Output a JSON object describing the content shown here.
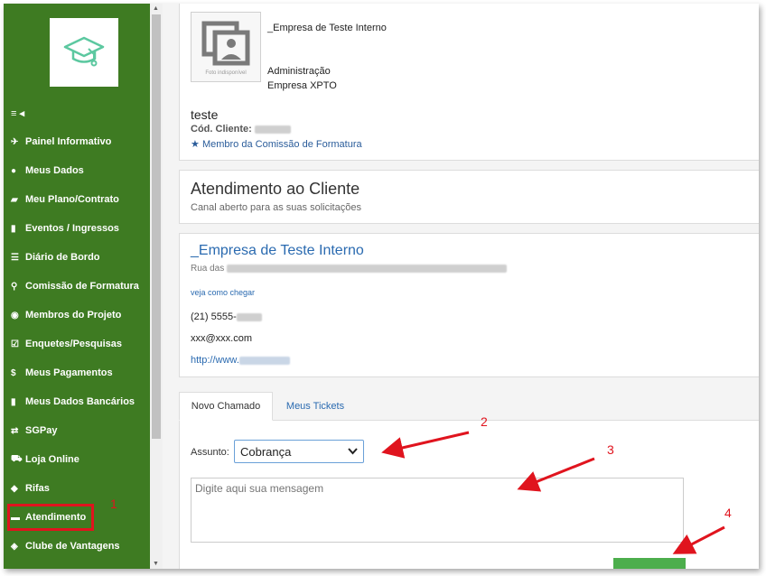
{
  "sidebar": {
    "logo": "graduation-cap-logo",
    "toggle_icon": "≡ ◂",
    "items": [
      {
        "label": "Painel Informativo",
        "icon": "pin-icon",
        "glyph": "✈"
      },
      {
        "label": "Meus Dados",
        "icon": "user-icon",
        "glyph": "●"
      },
      {
        "label": "Meu Plano/Contrato",
        "icon": "folder-icon",
        "glyph": "▰"
      },
      {
        "label": "Eventos / Ingressos",
        "icon": "ticket-icon",
        "glyph": "▮"
      },
      {
        "label": "Diário de Bordo",
        "icon": "list-icon",
        "glyph": "☰"
      },
      {
        "label": "Comissão de Formatura",
        "icon": "link-icon",
        "glyph": "⚲"
      },
      {
        "label": "Membros do Projeto",
        "icon": "globe-icon",
        "glyph": "◉"
      },
      {
        "label": "Enquetes/Pesquisas",
        "icon": "checkbox-icon",
        "glyph": "☑"
      },
      {
        "label": "Meus Pagamentos",
        "icon": "dollar-icon",
        "glyph": "$"
      },
      {
        "label": "Meus Dados Bancários",
        "icon": "bank-icon",
        "glyph": "▮"
      },
      {
        "label": "SGPay",
        "icon": "exchange-icon",
        "glyph": "⇄"
      },
      {
        "label": "Loja Online",
        "icon": "cart-icon",
        "glyph": "⛟"
      },
      {
        "label": "Rifas",
        "icon": "piggy-icon",
        "glyph": "◆"
      },
      {
        "label": "Atendimento",
        "icon": "chat-icon",
        "glyph": "▬"
      },
      {
        "label": "Clube de Vantagens",
        "icon": "tag-icon",
        "glyph": "◈"
      }
    ]
  },
  "profile": {
    "company": "_Empresa de Teste Interno",
    "photo_caption": "Foto indisponível",
    "role": "Administração",
    "org": "Empresa XPTO",
    "client_name": "teste",
    "client_code_label": "Cód. Cliente:",
    "member_label": "Membro da Comissão de Formatura"
  },
  "service": {
    "title": "Atendimento ao Cliente",
    "subtitle": "Canal aberto para as suas solicitações"
  },
  "company_info": {
    "name": "_Empresa de Teste Interno",
    "address_prefix": "Rua das",
    "map_link": "veja como chegar",
    "phone_prefix": "(21) 5555-",
    "email": "xxx@xxx.com",
    "site_prefix": "http://www."
  },
  "tickets": {
    "tab_new": "Novo Chamado",
    "tab_mine": "Meus Tickets",
    "subject_label": "Assunto:",
    "subject_value": "Cobrança",
    "message_placeholder": "Digite aqui sua mensagem"
  },
  "annotations": {
    "n1": "1",
    "n2": "2",
    "n3": "3",
    "n4": "4"
  },
  "colors": {
    "sidebar_bg": "#3e7b22",
    "highlight_red": "#e0141e",
    "link_blue": "#2a6ab0",
    "send_green": "#4cae4c"
  }
}
